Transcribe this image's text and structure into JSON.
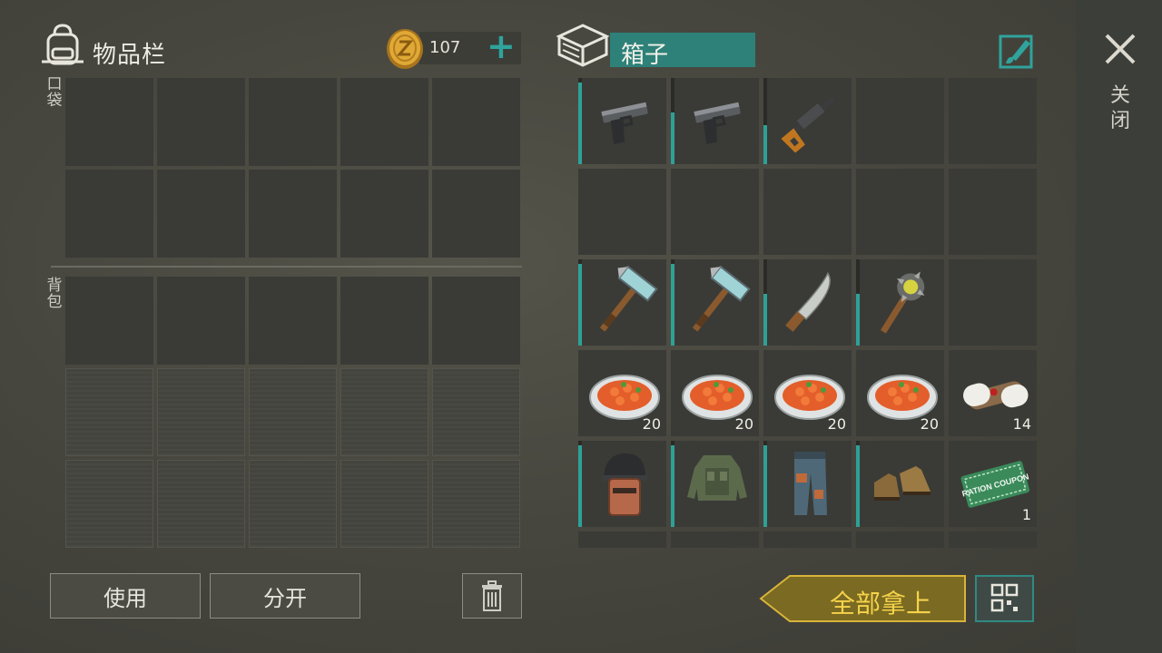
{
  "inventory": {
    "title": "物品栏",
    "coins": "107",
    "add_label": "+",
    "pocket_label": "口袋",
    "backpack_label": "背包"
  },
  "container": {
    "title": "箱子",
    "rows": [
      [
        {
          "icon": "pistol-icon",
          "durability": 0.95
        },
        {
          "icon": "pistol-icon",
          "durability": 0.6
        },
        {
          "icon": "rifle-icon",
          "durability": 0.45
        },
        {
          "icon": ""
        },
        {
          "icon": ""
        }
      ],
      [
        {
          "icon": ""
        },
        {
          "icon": ""
        },
        {
          "icon": ""
        },
        {
          "icon": ""
        },
        {
          "icon": ""
        }
      ],
      [
        {
          "icon": "hammer-icon",
          "durability": 0.95
        },
        {
          "icon": "hammer-icon",
          "durability": 0.95
        },
        {
          "icon": "machete-icon",
          "durability": 0.6
        },
        {
          "icon": "spiked-club-icon",
          "durability": 0.6
        },
        {
          "icon": ""
        }
      ],
      [
        {
          "icon": "food-plate-icon",
          "qty": "20"
        },
        {
          "icon": "food-plate-icon",
          "qty": "20"
        },
        {
          "icon": "food-plate-icon",
          "qty": "20"
        },
        {
          "icon": "food-plate-icon",
          "qty": "20"
        },
        {
          "icon": "bandage-icon",
          "qty": "14"
        }
      ],
      [
        {
          "icon": "helmet-icon",
          "durability": 0.95
        },
        {
          "icon": "armor-vest-icon",
          "durability": 0.95
        },
        {
          "icon": "pants-icon",
          "durability": 0.95
        },
        {
          "icon": "boots-icon",
          "durability": 0.95
        },
        {
          "icon": "coupon-icon",
          "qty": "1",
          "coupon_text": "RATION COUPON"
        }
      ]
    ]
  },
  "buttons": {
    "use": "使用",
    "split": "分开",
    "take_all": "全部拿上",
    "close": "关闭"
  },
  "colors": {
    "accent": "#2e8179",
    "take_all_text": "#f5d34a",
    "take_all_bg": "#7a6a22"
  }
}
